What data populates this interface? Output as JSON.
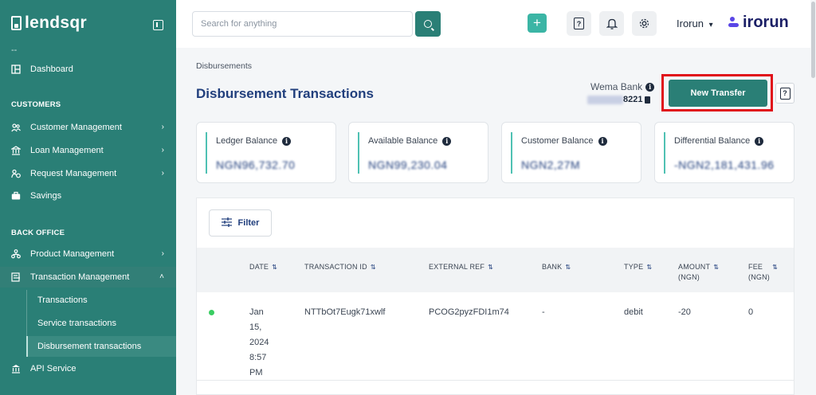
{
  "sidebar": {
    "brand": "lendsqr",
    "dash_marker": "--",
    "dashboard_label": "Dashboard",
    "customers_section": "CUSTOMERS",
    "customer_management": "Customer Management",
    "loan_management": "Loan Management",
    "request_management": "Request Management",
    "savings": "Savings",
    "back_office_section": "BACK OFFICE",
    "product_management": "Product Management",
    "transaction_management": "Transaction Management",
    "sub_transactions": "Transactions",
    "sub_service_transactions": "Service transactions",
    "sub_disbursement_transactions": "Disbursement transactions",
    "api_service": "API Service",
    "chevron_right": "›",
    "chevron_up": "˄"
  },
  "topbar": {
    "search_placeholder": "Search for anything",
    "plus_glyph": "+",
    "bell_glyph": "🔔",
    "gear_glyph": "⚙",
    "help_glyph": "?",
    "user_name": "Irorun",
    "caret": "▾",
    "org_logo": "irorun"
  },
  "page": {
    "breadcrumb": "Disbursements",
    "title": "Disbursement Transactions",
    "bank_name": "Wema Bank",
    "account_suffix": "8221",
    "new_transfer_label": "New Transfer",
    "info_glyph": "i",
    "help_glyph": "?"
  },
  "cards": [
    {
      "label": "Ledger Balance",
      "value": "NGN96,732.70"
    },
    {
      "label": "Available Balance",
      "value": "NGN99,230.04"
    },
    {
      "label": "Customer Balance",
      "value": "NGN2,27M"
    },
    {
      "label": "Differential Balance",
      "value": "-NGN2,181,431.96"
    }
  ],
  "table": {
    "filter_label": "Filter",
    "sort_glyph": "⇅",
    "columns": [
      "DATE",
      "TRANSACTION ID",
      "EXTERNAL REF",
      "BANK",
      "TYPE",
      "AMOUNT",
      "(NGN)",
      "FEE",
      "(NGN)"
    ],
    "rows": [
      {
        "date_lines": [
          "Jan",
          "15,",
          "2024",
          "8:57",
          "PM"
        ],
        "transaction_id": "NTTbOt7Eugk71xwlf",
        "external_ref": "PCOG2pyzFDI1m74",
        "bank": "-",
        "type": "debit",
        "amount": "-20",
        "fee": "0"
      }
    ]
  },
  "colors": {
    "sidebar": "#2a7f76",
    "accent": "#2a7f76",
    "title": "#213f7d",
    "highlight": "#e0101a",
    "status_success": "#39cd62"
  }
}
